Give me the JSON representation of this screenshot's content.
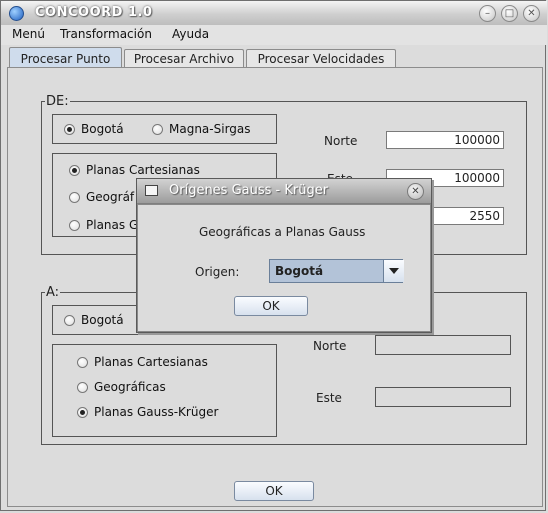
{
  "window": {
    "title": "CONCOORD 1.0"
  },
  "menu": [
    "Menú",
    "Transformación",
    "Ayuda"
  ],
  "tabs": [
    "Procesar Punto",
    "Procesar Archivo",
    "Procesar Velocidades"
  ],
  "de": {
    "legend": "DE:",
    "datums": [
      "Bogotá",
      "Magna-Sirgas"
    ],
    "systems": [
      "Planas Cartesianas",
      "Geográf",
      "Planas G"
    ],
    "norte_label": "Norte",
    "norte_value": "100000",
    "este_label": "Este",
    "este_value": "100000",
    "third_value": "2550"
  },
  "a": {
    "legend": "A:",
    "datum": "Bogotá",
    "systems": [
      "Planas Cartesianas",
      "Geográficas",
      "Planas Gauss-Krüger"
    ],
    "norte_label": "Norte",
    "este_label": "Este"
  },
  "ok_label": "OK",
  "dialog": {
    "title": "Orígenes Gauss - Krüger",
    "heading": "Geográficas a Planas Gauss",
    "origin_label": "Origen:",
    "origin_value": "Bogotá",
    "ok_label": "OK"
  }
}
